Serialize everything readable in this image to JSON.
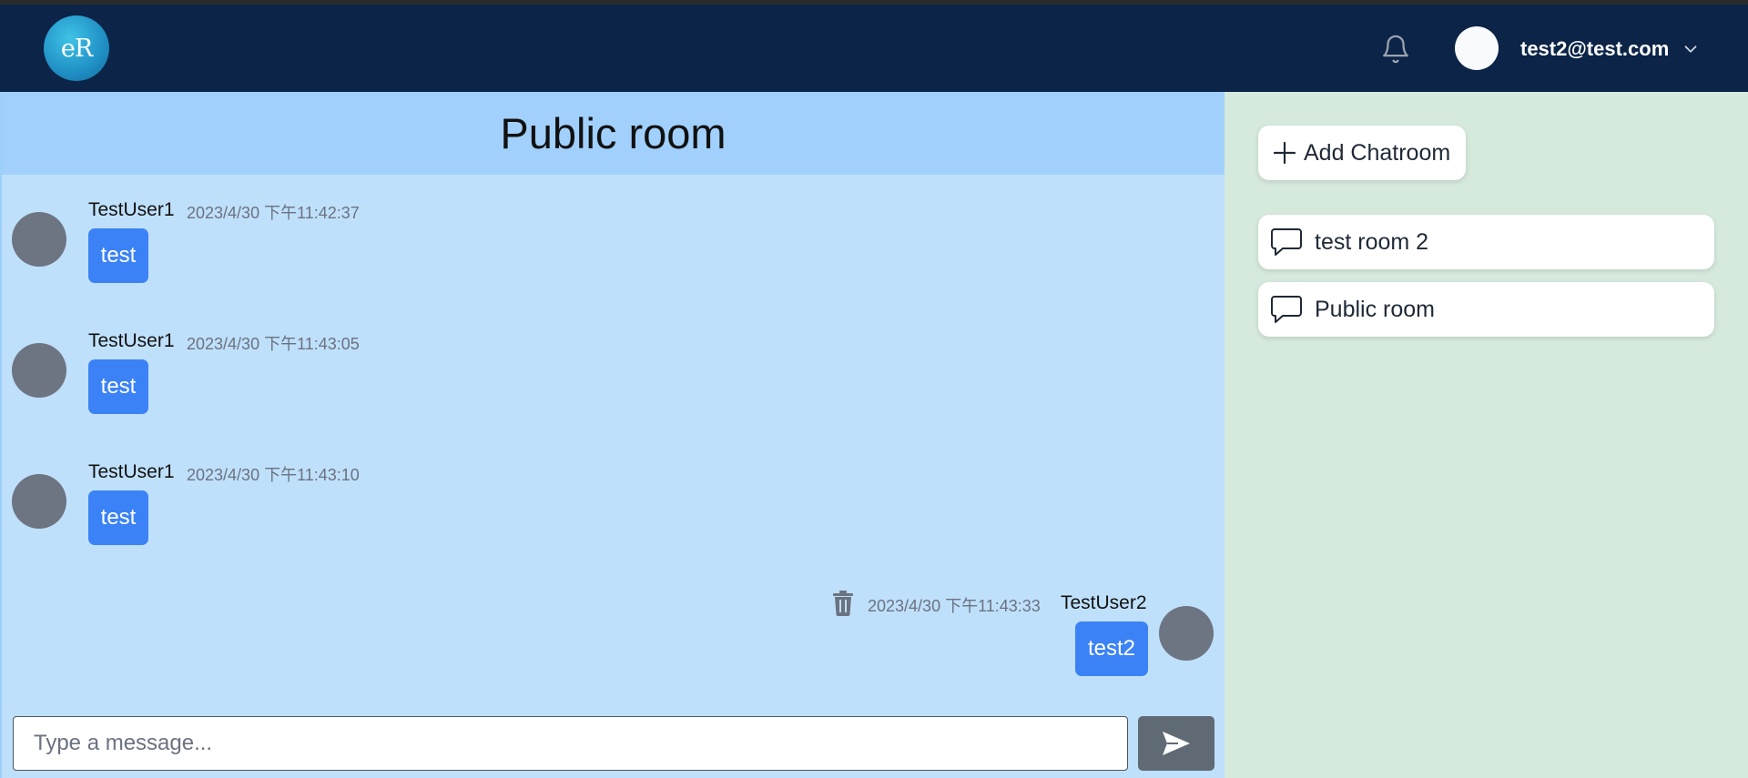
{
  "header": {
    "logo_text": "eR",
    "user_email": "test2@test.com"
  },
  "room": {
    "title": "Public room"
  },
  "messages": [
    {
      "user": "TestUser1",
      "time": "2023/4/30 下午11:42:37",
      "text": "test",
      "own": false
    },
    {
      "user": "TestUser1",
      "time": "2023/4/30 下午11:43:05",
      "text": "test",
      "own": false
    },
    {
      "user": "TestUser1",
      "time": "2023/4/30 下午11:43:10",
      "text": "test",
      "own": false
    },
    {
      "user": "TestUser2",
      "time": "2023/4/30 下午11:43:33",
      "text": "test2",
      "own": true
    }
  ],
  "composer": {
    "placeholder": "Type a message..."
  },
  "sidebar": {
    "add_label": "Add Chatroom",
    "rooms": [
      {
        "label": "test room 2"
      },
      {
        "label": "Public room"
      }
    ]
  },
  "icons": {
    "bell": "bell-icon",
    "chevron": "chevron-down-icon",
    "plus": "plus-icon",
    "chat": "chat-bubble-icon",
    "trash": "trash-icon",
    "send": "send-icon"
  },
  "colors": {
    "navbar": "#0b2447",
    "bubble": "#3b82f6",
    "chat_bg": "#bfe0fb",
    "sidebar_bg": "#d6e9dd"
  }
}
